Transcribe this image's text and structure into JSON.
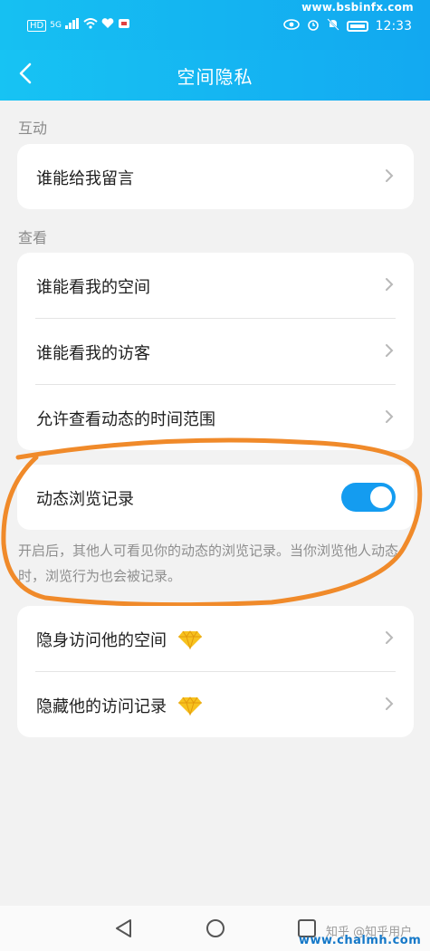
{
  "status_bar": {
    "left": [
      "HD",
      "5G"
    ],
    "time": "12:33",
    "watermark_top": "www.bsbinfx.com"
  },
  "header": {
    "title": "空间隐私",
    "back_icon": "chevron-left-icon"
  },
  "sections": {
    "interaction": {
      "label": "互动",
      "items": [
        {
          "label": "谁能给我留言"
        }
      ]
    },
    "view": {
      "label": "查看",
      "items": [
        {
          "label": "谁能看我的空间"
        },
        {
          "label": "谁能看我的访客"
        },
        {
          "label": "允许查看动态的时间范围"
        }
      ]
    },
    "browse_record": {
      "label": "动态浏览记录",
      "toggle_on": true,
      "description": "开启后，其他人可看见你的动态的浏览记录。当你浏览他人动态时，浏览行为也会被记录。"
    },
    "vip": {
      "items": [
        {
          "label": "隐身访问他的空间",
          "icon": "diamond-icon"
        },
        {
          "label": "隐藏他的访问记录",
          "icon": "diamond-icon"
        }
      ]
    }
  },
  "colors": {
    "header": "#13a9f1",
    "toggle": "#149cf0",
    "annotation": "#f08a2a",
    "gem": "#f7c21e"
  },
  "watermark": {
    "zhihu": "知乎 @知乎用户",
    "site": "www.chalmh.com"
  }
}
